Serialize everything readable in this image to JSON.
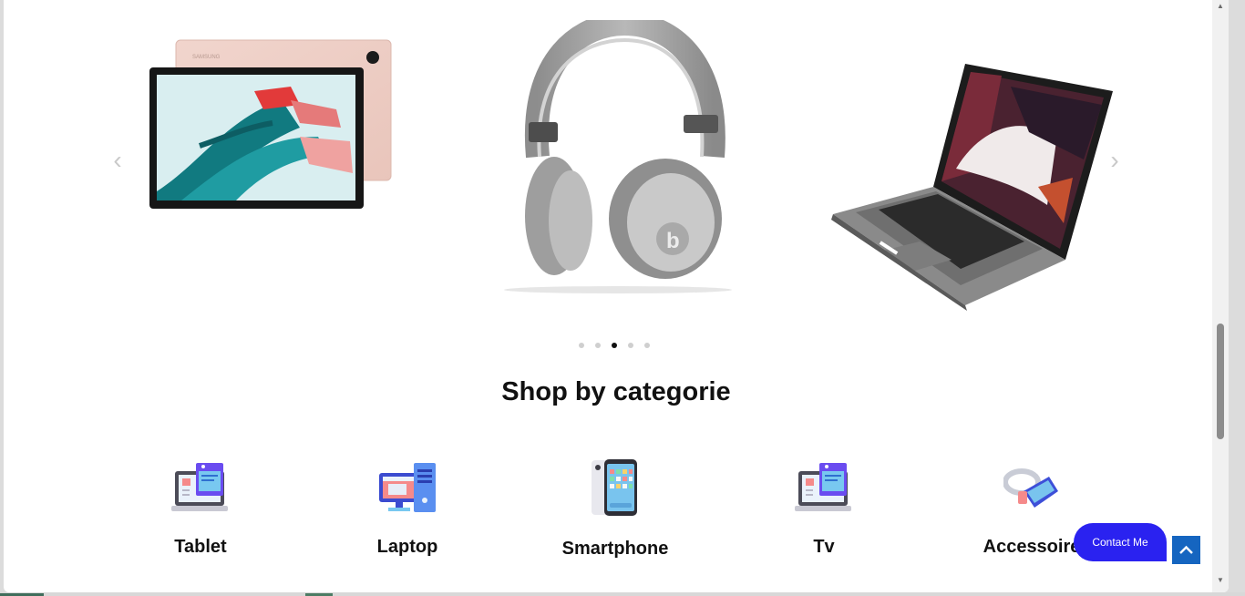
{
  "carousel": {
    "prev_icon": "chevron-left-icon",
    "next_icon": "chevron-right-icon",
    "slides": [
      {
        "product": "tablet",
        "brand_text": "SAMSUNG"
      },
      {
        "product": "headphones"
      },
      {
        "product": "laptop"
      }
    ],
    "dots_total": 5,
    "active_dot": 3
  },
  "section": {
    "title": "Shop by categorie"
  },
  "categories": [
    {
      "label": "Tablet",
      "icon": "tablet-icon"
    },
    {
      "label": "Laptop",
      "icon": "desktop-computer-icon"
    },
    {
      "label": "Smartphone",
      "icon": "smartphone-icon"
    },
    {
      "label": "Tv",
      "icon": "tv-icon"
    },
    {
      "label": "Accessoire",
      "icon": "vr-headset-icon"
    }
  ],
  "contact": {
    "label": "Contact Me"
  },
  "scroll_top": {
    "icon": "chevron-up-icon"
  },
  "colors": {
    "contact_bg": "#2a22f0",
    "scroll_top_bg": "#1565c0",
    "active_dot": "#111111",
    "inactive_dot": "#cfcfcf"
  }
}
